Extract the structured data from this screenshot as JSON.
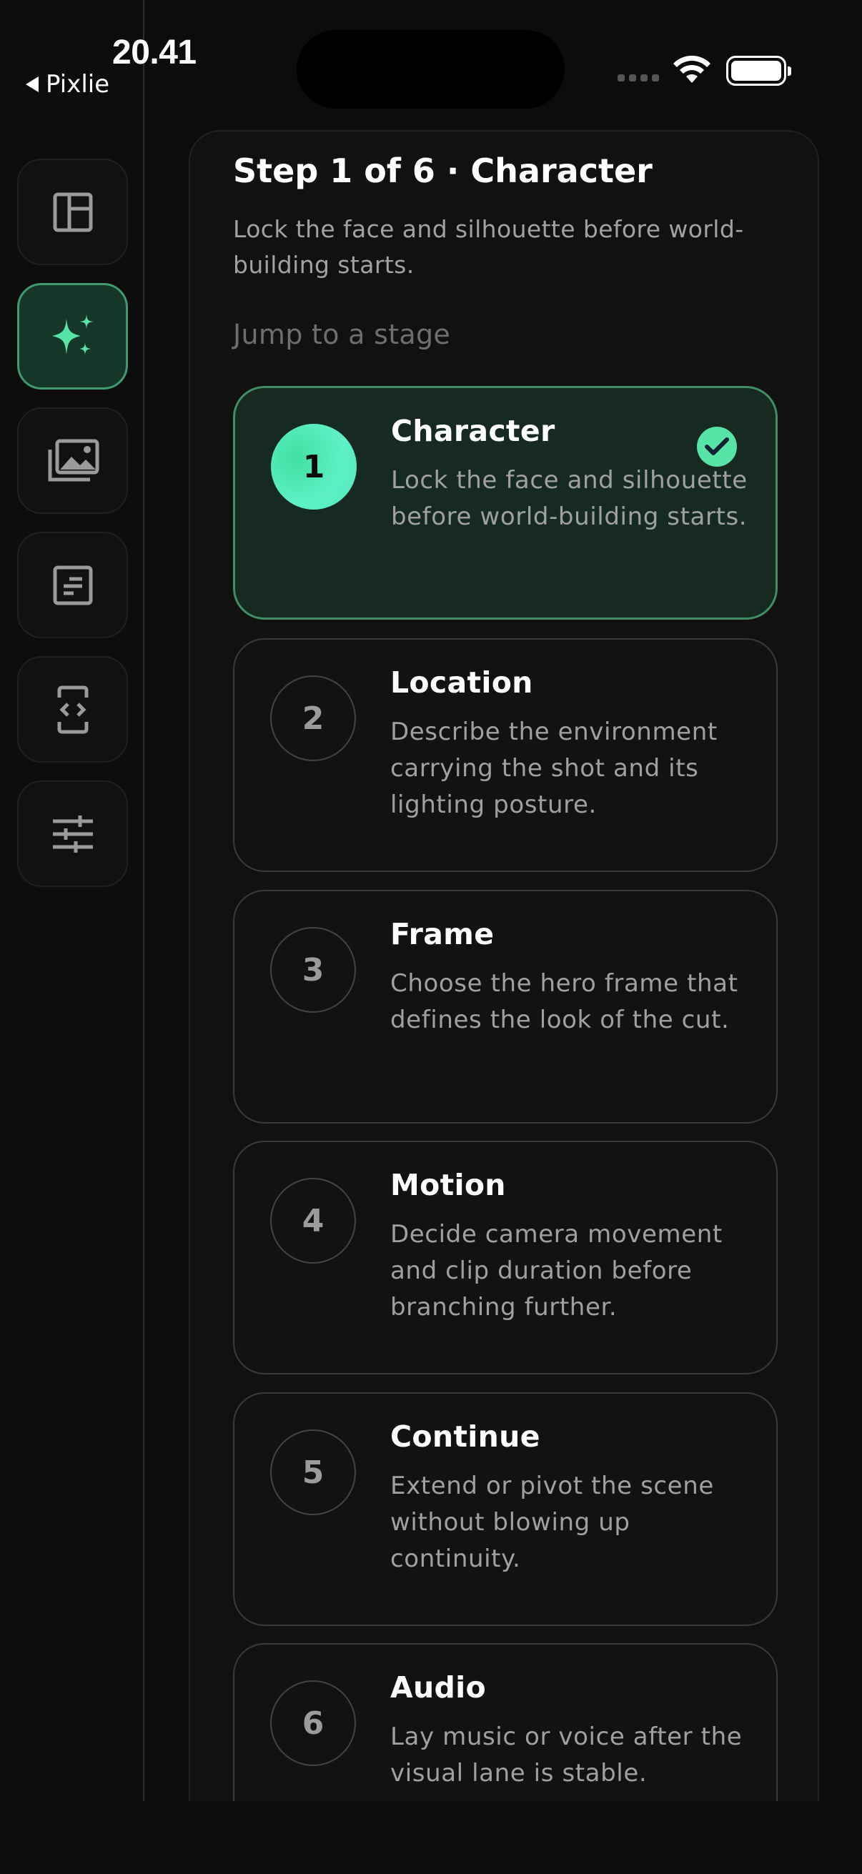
{
  "status_bar": {
    "time": "20.41",
    "back_label": "Pixlie"
  },
  "sidebar": {
    "items": [
      {
        "name": "layout-icon",
        "active": false
      },
      {
        "name": "sparkles-icon",
        "active": true
      },
      {
        "name": "gallery-icon",
        "active": false
      },
      {
        "name": "document-icon",
        "active": false
      },
      {
        "name": "code-device-icon",
        "active": false
      },
      {
        "name": "sliders-icon",
        "active": false
      }
    ]
  },
  "wizard": {
    "step_title": "Step 1 of 6 · Character",
    "step_description": "Lock the face and silhouette before world-building starts.",
    "jump_label": "Jump to a stage",
    "stages": [
      {
        "number": "1",
        "title": "Character",
        "description": "Lock the face and silhouette before world-building starts.",
        "active": true
      },
      {
        "number": "2",
        "title": "Location",
        "description": "Describe the environment carrying the shot and its lighting posture.",
        "active": false
      },
      {
        "number": "3",
        "title": "Frame",
        "description": "Choose the hero frame that defines the look of the cut.",
        "active": false
      },
      {
        "number": "4",
        "title": "Motion",
        "description": "Decide camera movement and clip duration before branching further.",
        "active": false
      },
      {
        "number": "5",
        "title": "Continue",
        "description": "Extend or pivot the scene without blowing up continuity.",
        "active": false
      },
      {
        "number": "6",
        "title": "Audio",
        "description": "Lay music or voice after the visual lane is stable.",
        "active": false
      }
    ]
  },
  "colors": {
    "accent": "#56e5a6",
    "active_card_border": "#3e8e66",
    "background": "#0c0c0c"
  }
}
